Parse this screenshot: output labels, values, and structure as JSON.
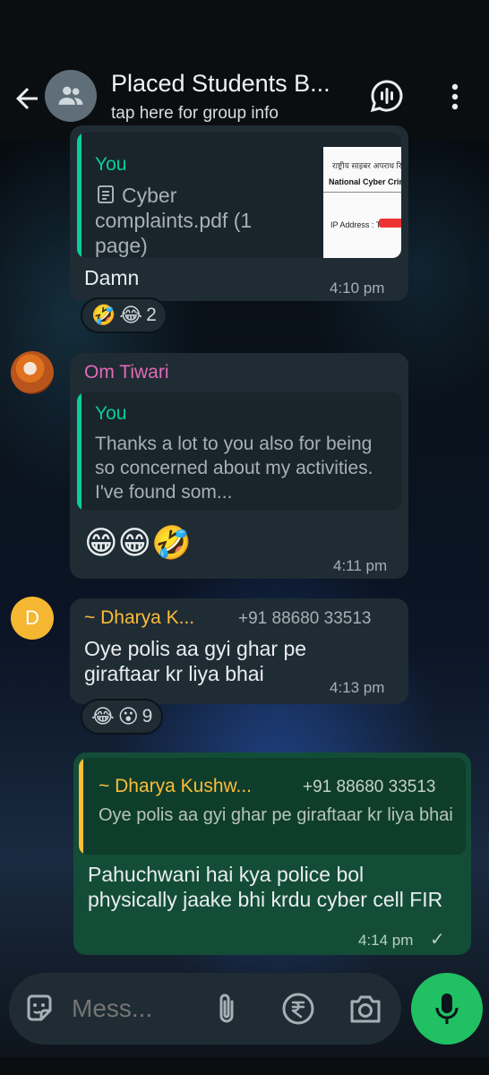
{
  "header": {
    "title": "Placed Students B...",
    "subtitle": "tap here for group info"
  },
  "messages": [
    {
      "quote_sender": "You",
      "quote_doc": "Cyber complaints.pdf (1 page)",
      "thumb_line1": "राष्ट्रीय साइबर अपराध रिपोर्टिंग",
      "thumb_line2": "National Cyber Crime Rep",
      "thumb_line3": "IP Address : T",
      "text": "Damn",
      "time": "4:10 pm",
      "reactions": {
        "emoji1": "🤣",
        "emoji2": "😂",
        "count": "2"
      }
    },
    {
      "sender": "Om Tiwari",
      "quote_sender": "You",
      "quote_text": "Thanks a lot to you also for being so concerned about my activities. I've found som...",
      "text": "😁😁🤣",
      "time": "4:11 pm"
    },
    {
      "avatar_letter": "D",
      "sender": "~ Dharya K...",
      "phone": "+91 88680 33513",
      "text": "Oye polis aa gyi ghar pe giraftaar kr liya bhai",
      "time": "4:13 pm",
      "reactions": {
        "emoji1": "😂",
        "emoji2": "😮",
        "count": "9"
      }
    },
    {
      "quote_sender": "~ Dharya Kushw...",
      "quote_phone": "+91 88680 33513",
      "quote_text": "Oye polis aa gyi ghar pe giraftaar kr liya bhai",
      "text": "Pahuchwani hai kya police bol physically jaake bhi krdu cyber cell FIR",
      "time": "4:14 pm",
      "status": "✓"
    }
  ],
  "composer": {
    "placeholder": "Mess..."
  },
  "colors": {
    "accent_green": "#21c063",
    "in_bubble": "#1f2c34",
    "out_bubble": "#134d37",
    "you_bar": "#06cf9c",
    "om_name": "#e26ab6",
    "dharya_name": "#ffbc38",
    "avatar_d": "#f5b731"
  }
}
